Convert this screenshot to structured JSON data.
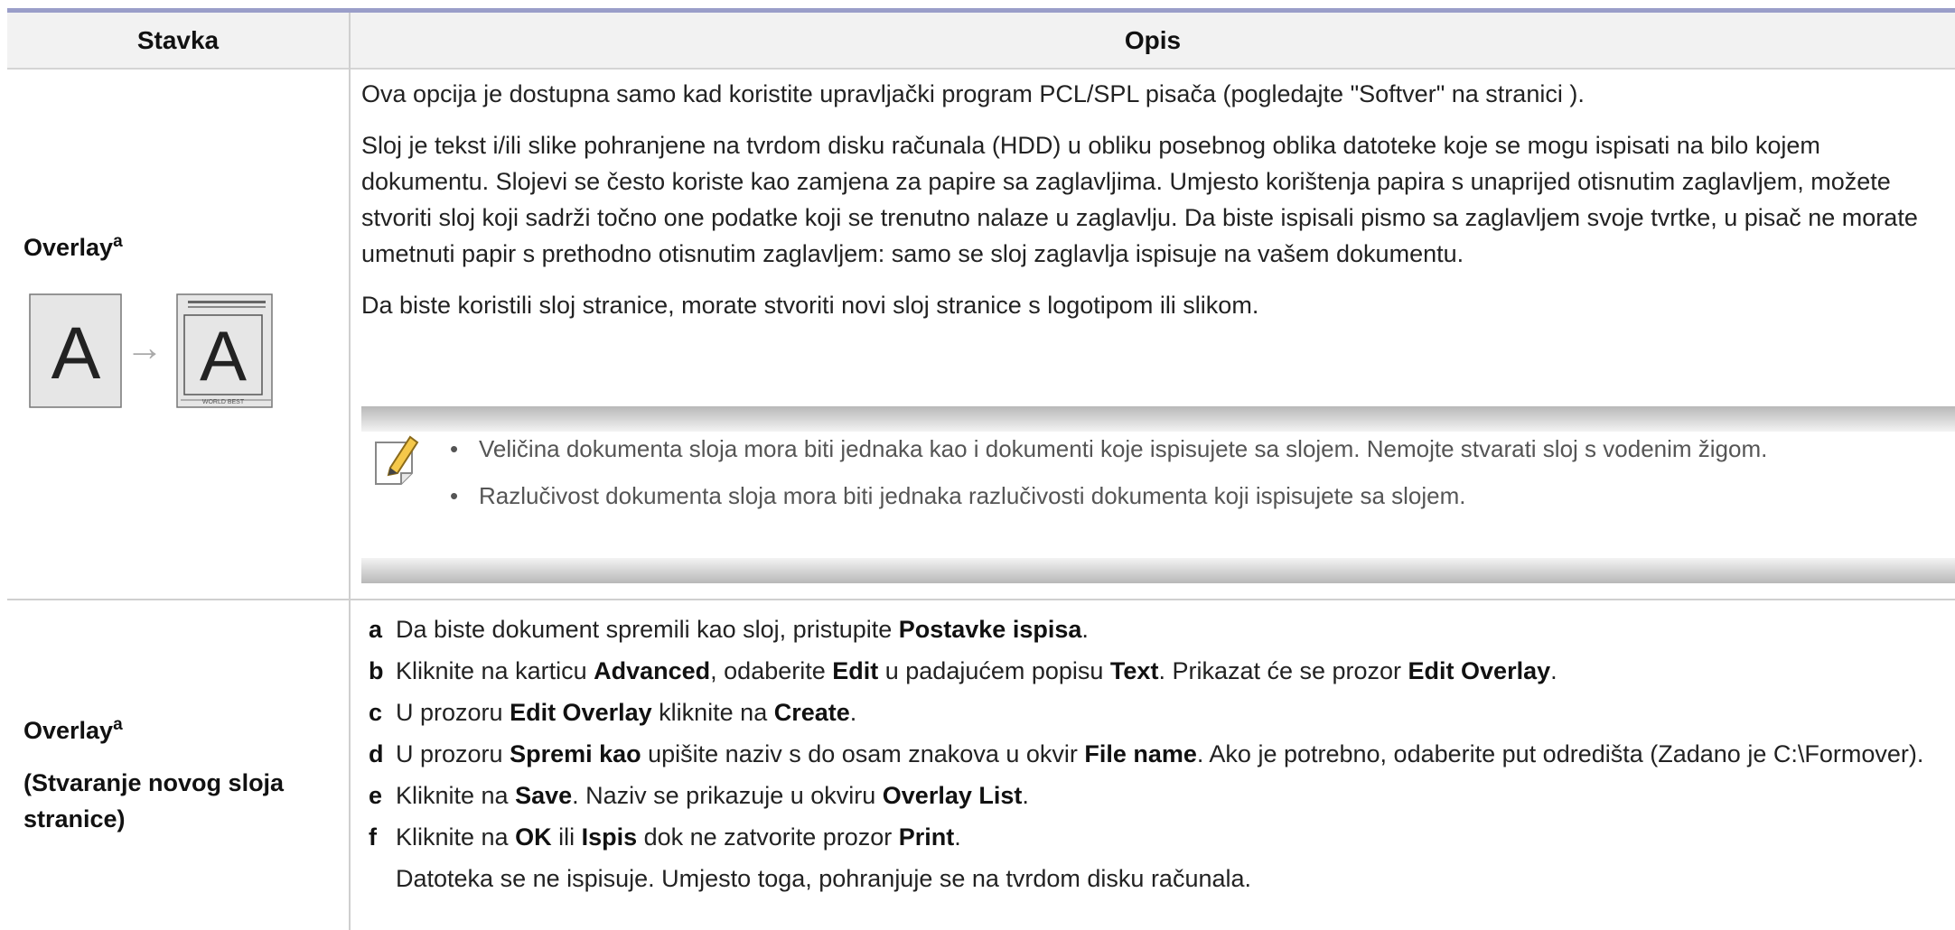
{
  "header": {
    "col1": "Stavka",
    "col2": "Opis"
  },
  "row1": {
    "item_label": "Overlay",
    "item_sup": "a",
    "figure": {
      "left_letter": "A",
      "right_letter": "A",
      "caption": "WORLD BEST",
      "arrow": "→"
    },
    "paragraphs": [
      "Ova opcija je dostupna samo kad koristite upravljački program PCL/SPL pisača (pogledajte \"Softver\" na stranici ).",
      "Sloj je tekst i/ili slike pohranjene na tvrdom disku računala (HDD) u obliku posebnog oblika datoteke koje se mogu ispisati na bilo kojem dokumentu. Slojevi se često koriste kao zamjena za papire sa zaglavljima. Umjesto korištenja papira s unaprijed otisnutim zaglavljem, možete stvoriti sloj koji sadrži točno one podatke koji se trenutno nalaze u zaglavlju. Da biste ispisali pismo sa zaglavljem svoje tvrtke, u pisač ne morate umetnuti papir s prethodno otisnutim zaglavljem: samo se sloj zaglavlja ispisuje na vašem dokumentu.",
      "Da biste koristili sloj stranice, morate stvoriti novi sloj stranice s logotipom ili slikom."
    ],
    "note": {
      "icon": "note-pencil-icon",
      "bullet": "•",
      "items": [
        "Veličina dokumenta sloja mora biti jednaka kao i dokumenti koje ispisujete sa slojem. Nemojte stvarati sloj s vodenim žigom.",
        "Razlučivost dokumenta sloja mora biti jednaka razlučivosti dokumenta koji ispisujete sa slojem."
      ]
    }
  },
  "row2": {
    "item_label": "Overlay",
    "item_sup": "a",
    "item_sub": "(Stvaranje novog sloja stranice)",
    "steps": [
      {
        "letter": "a",
        "parts": [
          {
            "t": "Da biste dokument spremili kao sloj, pristupite "
          },
          {
            "t": "Postavke ispisa",
            "b": true
          },
          {
            "t": "."
          }
        ]
      },
      {
        "letter": "b",
        "parts": [
          {
            "t": "Kliknite na karticu "
          },
          {
            "t": "Advanced",
            "b": true
          },
          {
            "t": ", odaberite "
          },
          {
            "t": "Edit",
            "b": true
          },
          {
            "t": " u padajućem popisu "
          },
          {
            "t": "Text",
            "b": true
          },
          {
            "t": ". Prikazat će se prozor "
          },
          {
            "t": "Edit Overlay",
            "b": true
          },
          {
            "t": "."
          }
        ]
      },
      {
        "letter": "c",
        "parts": [
          {
            "t": "U prozoru "
          },
          {
            "t": "Edit Overlay",
            "b": true
          },
          {
            "t": " kliknite na "
          },
          {
            "t": "Create",
            "b": true
          },
          {
            "t": "."
          }
        ]
      },
      {
        "letter": "d",
        "parts": [
          {
            "t": "U prozoru "
          },
          {
            "t": "Spremi kao",
            "b": true
          },
          {
            "t": " upišite naziv s do osam znakova u okvir "
          },
          {
            "t": "File name",
            "b": true
          },
          {
            "t": ". Ako je potrebno, odaberite put odredišta (Zadano je C:\\Formover)."
          }
        ]
      },
      {
        "letter": "e",
        "parts": [
          {
            "t": "Kliknite na "
          },
          {
            "t": "Save",
            "b": true
          },
          {
            "t": ". Naziv se prikazuje u okviru "
          },
          {
            "t": "Overlay List",
            "b": true
          },
          {
            "t": "."
          }
        ]
      },
      {
        "letter": "f",
        "parts": [
          {
            "t": "Kliknite na "
          },
          {
            "t": "OK",
            "b": true
          },
          {
            "t": " ili "
          },
          {
            "t": "Ispis",
            "b": true
          },
          {
            "t": " dok ne zatvorite prozor "
          },
          {
            "t": "Print",
            "b": true
          },
          {
            "t": "."
          }
        ]
      }
    ],
    "final_note": "Datoteka se ne ispisuje. Umjesto toga, pohranjuje se na tvrdom disku računala."
  }
}
